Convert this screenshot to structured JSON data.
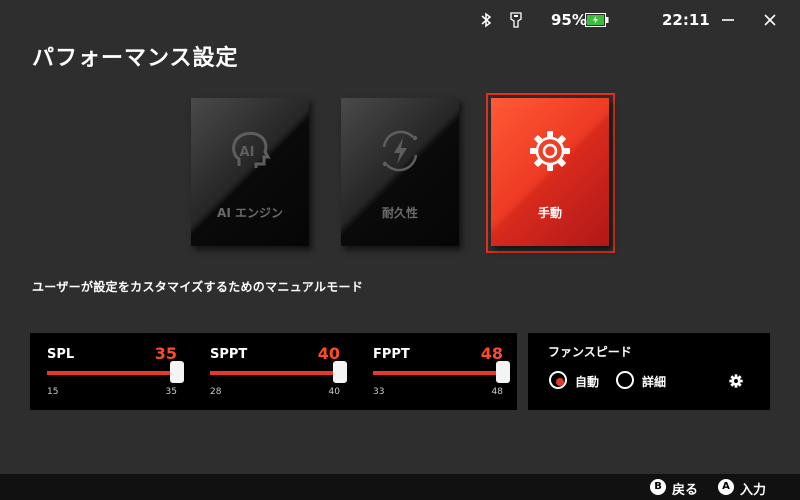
{
  "status": {
    "battery_percent": "95%",
    "time": "22:11",
    "icons": [
      "bluetooth-icon",
      "storage-card-icon",
      "battery-icon"
    ]
  },
  "window": {
    "minimize_icon": "minimize-icon",
    "close_icon": "close-icon"
  },
  "page": {
    "title": "パフォーマンス設定"
  },
  "modes": [
    {
      "label": "AI エンジン",
      "icon": "ai-engine-icon",
      "selected": false
    },
    {
      "label": "耐久性",
      "icon": "durability-icon",
      "selected": false
    },
    {
      "label": "手動",
      "icon": "gear-icon",
      "selected": true
    }
  ],
  "description": "ユーザーが設定をカスタマイズするためのマニュアルモード",
  "sliders": [
    {
      "label": "SPL",
      "value": "35",
      "min": "15",
      "max": "35",
      "fill": 1.0
    },
    {
      "label": "SPPT",
      "value": "40",
      "min": "28",
      "max": "40",
      "fill": 1.0
    },
    {
      "label": "FPPT",
      "value": "48",
      "min": "33",
      "max": "48",
      "fill": 1.0
    }
  ],
  "fan": {
    "title": "ファンスピード",
    "options": [
      {
        "label": "自動",
        "selected": true
      },
      {
        "label": "詳細",
        "selected": false
      }
    ],
    "settings_icon": "gear-icon"
  },
  "footer": {
    "back": {
      "key": "B",
      "label": "戻る"
    },
    "enter": {
      "key": "A",
      "label": "入力"
    }
  },
  "colors": {
    "accent": "#e8362a",
    "background": "#2e2e2e",
    "panel": "#000000"
  }
}
